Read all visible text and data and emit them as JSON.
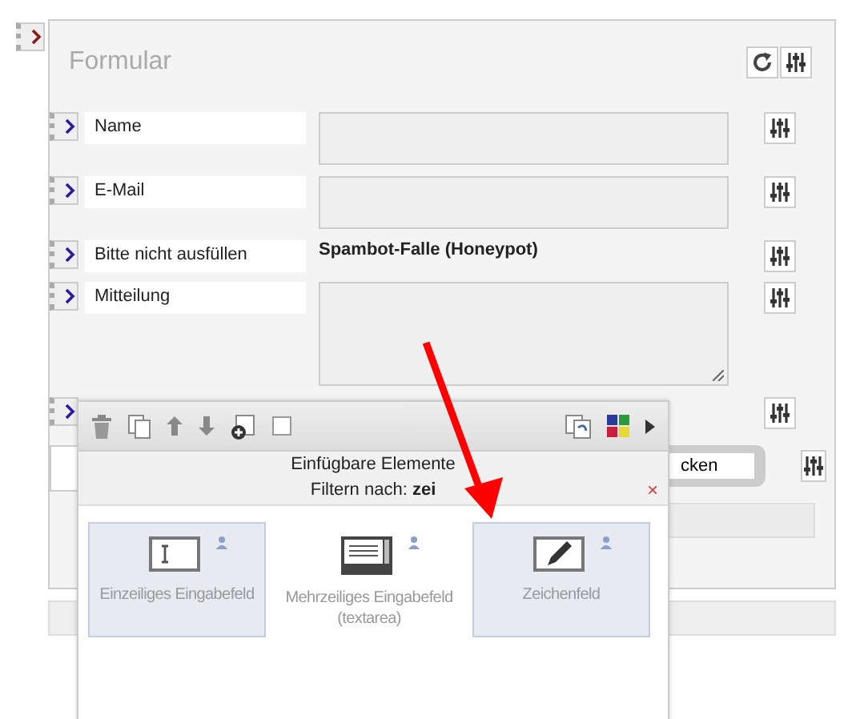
{
  "panel": {
    "title": "Formular"
  },
  "fields": [
    {
      "kind": "text",
      "label": "Name"
    },
    {
      "kind": "text",
      "label": "E-Mail"
    },
    {
      "kind": "honeypot",
      "label": "Bitte nicht ausfüllen",
      "value": "Spambot-Falle (Honeypot)"
    },
    {
      "kind": "textarea",
      "label": "Mitteilung"
    },
    {
      "kind": "covered"
    },
    {
      "kind": "submit",
      "button": "cken"
    }
  ],
  "popup": {
    "title": "Einfügbare Elemente",
    "filter_label": "Filtern nach:",
    "filter_value": "zei",
    "close": "×",
    "toolbar_checkbox": {
      "checked": false
    },
    "elements": [
      {
        "kind": "input",
        "label": "Einzeiliges Eingabefeld",
        "selected": true
      },
      {
        "kind": "textarea",
        "label": "Mehrzeiliges Eingabefeld (textarea)",
        "selected": false
      },
      {
        "kind": "drawing",
        "label": "Zeichenfeld",
        "selected": true
      }
    ]
  }
}
